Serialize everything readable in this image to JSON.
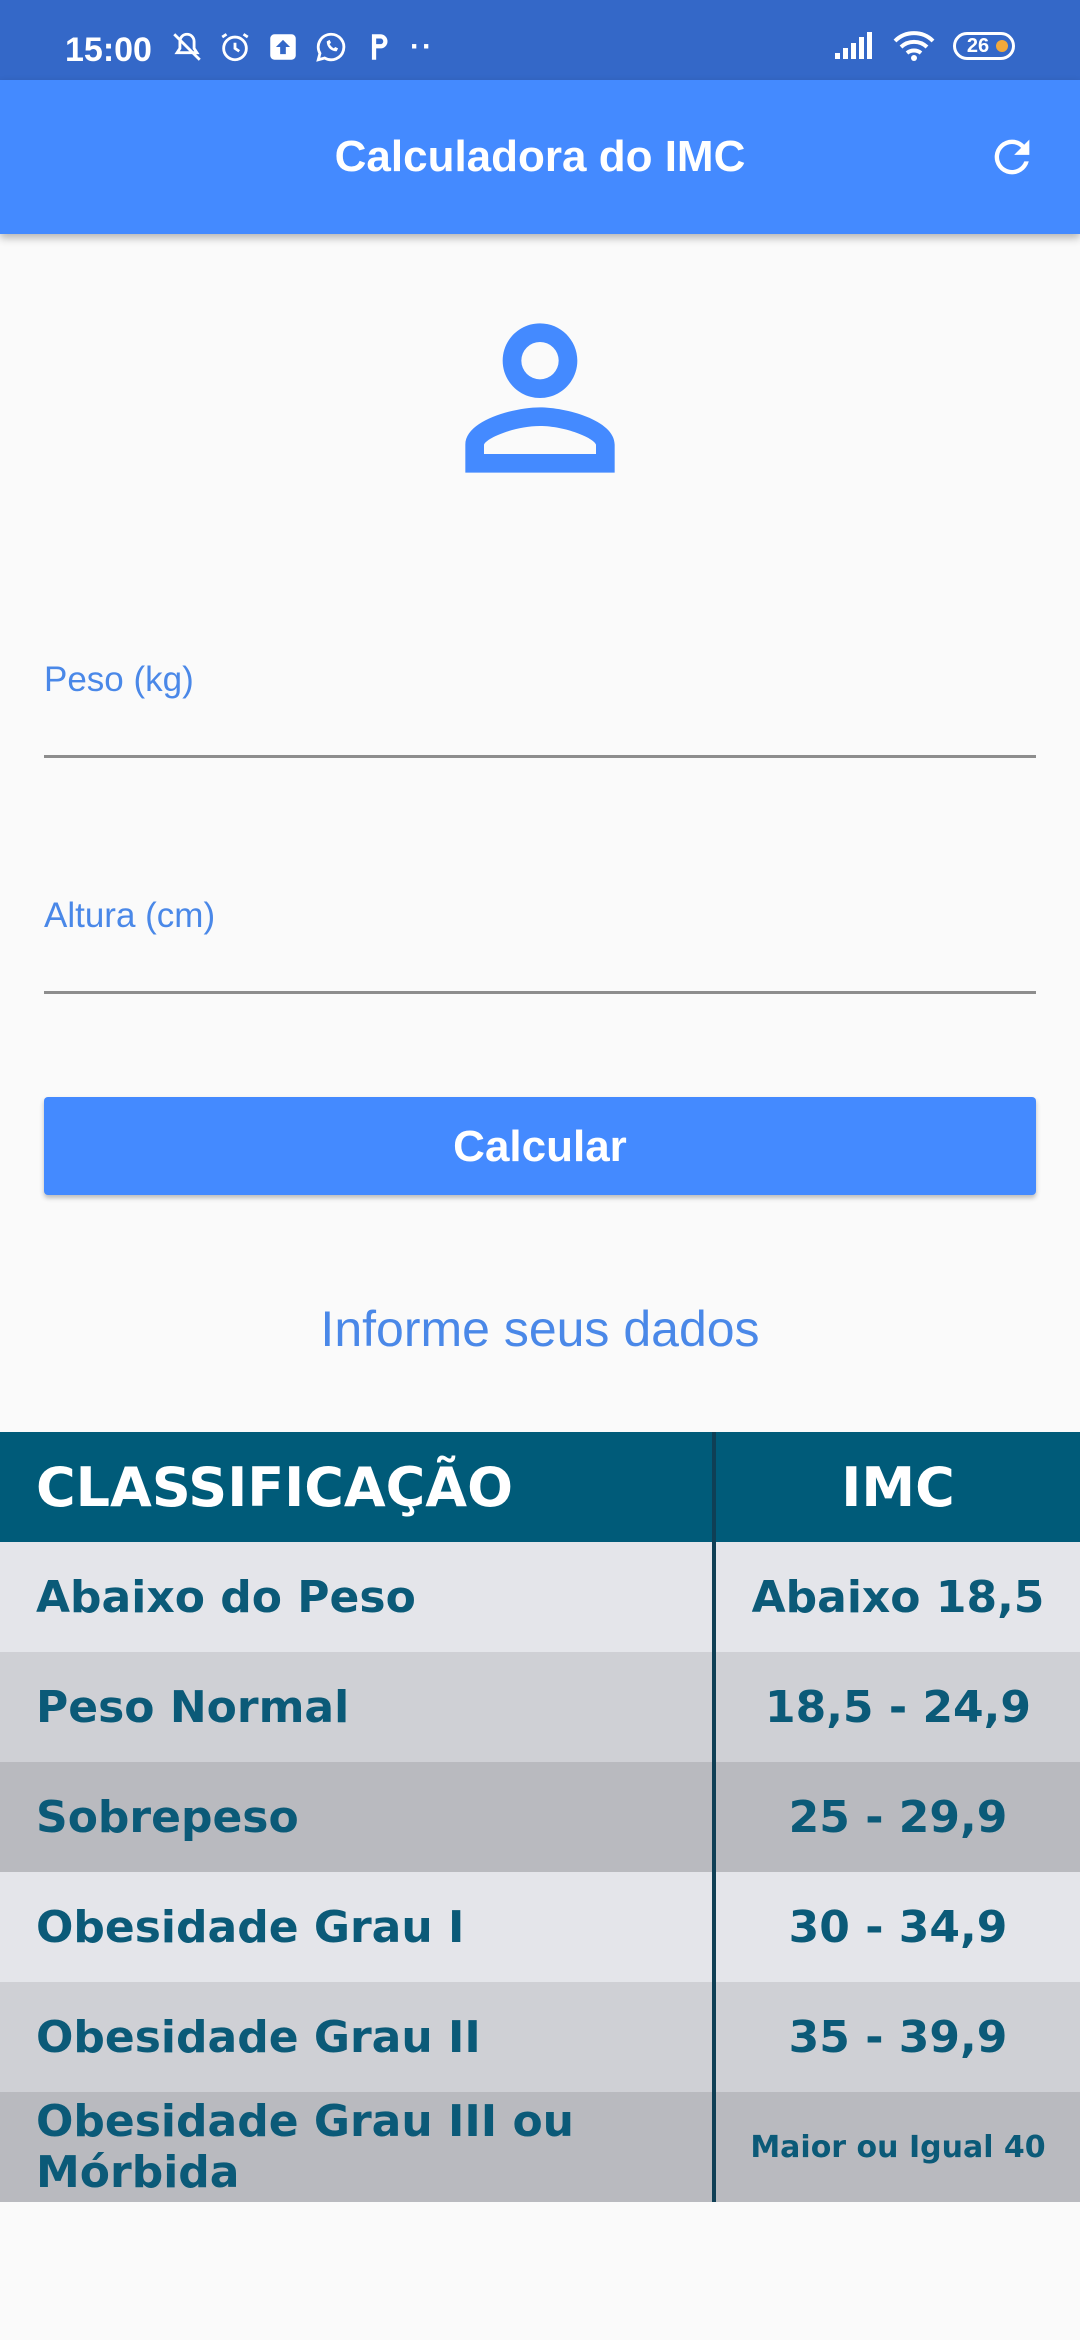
{
  "status_bar": {
    "time": "15:00",
    "battery": "26",
    "icons": [
      "mute-icon",
      "alarm-icon",
      "upload-icon",
      "whatsapp-icon",
      "p-icon",
      "more-dots",
      "signal-icon",
      "wifi-icon",
      "battery-icon"
    ]
  },
  "app_bar": {
    "title": "Calculadora do IMC",
    "refresh_icon": "refresh-icon"
  },
  "form": {
    "peso_label": "Peso (kg)",
    "peso_value": "",
    "altura_label": "Altura (cm)",
    "altura_value": "",
    "calc_button": "Calcular",
    "info_text": "Informe seus dados"
  },
  "table": {
    "headers": [
      "CLASSIFICAÇÃO",
      "IMC"
    ],
    "rows": [
      {
        "classification": "Abaixo do Peso",
        "imc": "Abaixo 18,5"
      },
      {
        "classification": "Peso Normal",
        "imc": "18,5 - 24,9"
      },
      {
        "classification": "Sobrepeso",
        "imc": "25 - 29,9"
      },
      {
        "classification": "Obesidade Grau I",
        "imc": "30 - 34,9"
      },
      {
        "classification": "Obesidade Grau II",
        "imc": "35 - 39,9"
      },
      {
        "classification": "Obesidade Grau III ou Mórbida",
        "imc": "Maior ou Igual 40"
      }
    ]
  },
  "colors": {
    "status_bar": "#3468c8",
    "primary": "#448aff",
    "label": "#4a88e8",
    "table_header": "#005b79",
    "table_text": "#0b5a78"
  }
}
